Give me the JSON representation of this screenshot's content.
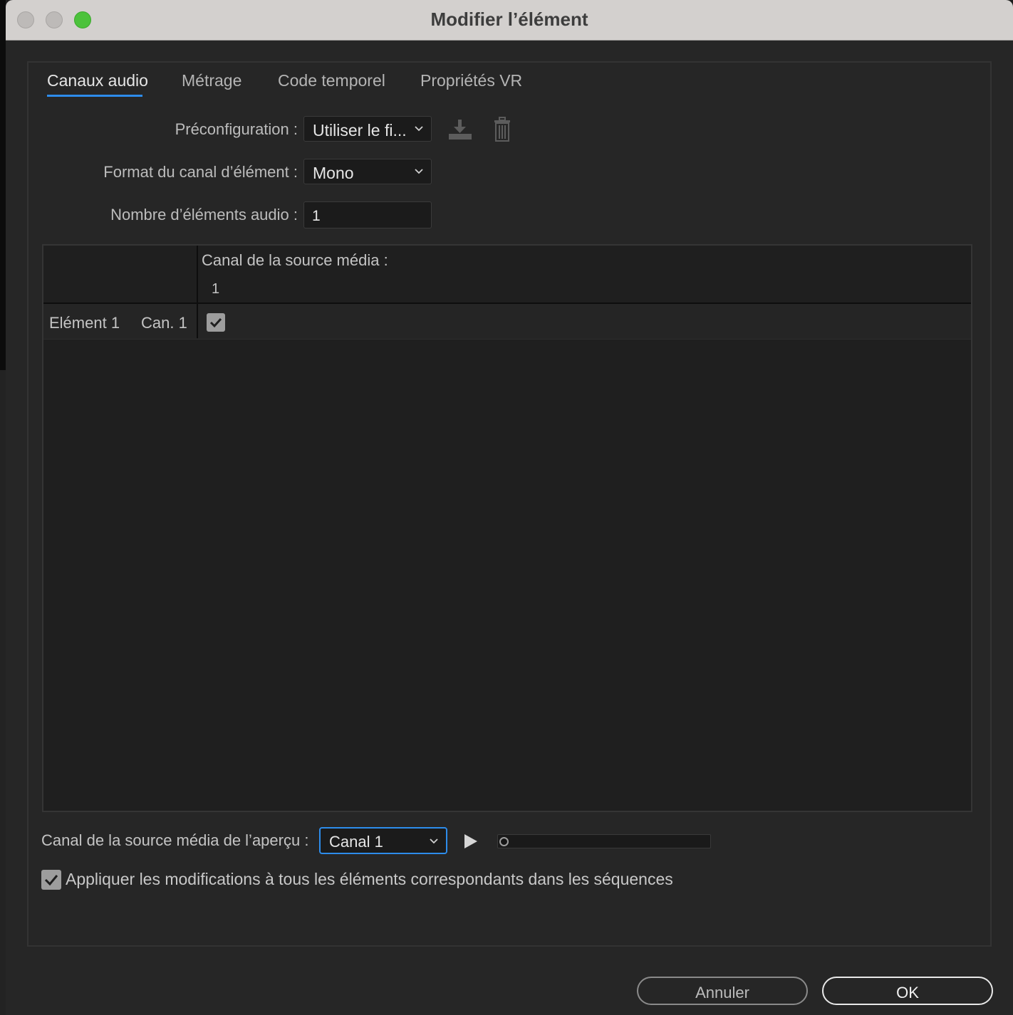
{
  "window": {
    "title": "Modifier l’élément"
  },
  "tabs": [
    {
      "label": "Canaux audio",
      "active": true
    },
    {
      "label": "Métrage",
      "active": false
    },
    {
      "label": "Code temporel",
      "active": false
    },
    {
      "label": "Propriétés VR",
      "active": false
    }
  ],
  "form": {
    "preset_label": "Préconfiguration :",
    "preset_value": "Utiliser le fi...",
    "format_label": "Format du canal d’élément :",
    "format_value": "Mono",
    "count_label": "Nombre d’éléments audio :",
    "count_value": "1"
  },
  "grid": {
    "source_header": "Canal de la source média :",
    "source_channels": [
      "1"
    ],
    "rows": [
      {
        "element": "Elément 1",
        "channel": "Can. 1",
        "checked": [
          true
        ]
      }
    ]
  },
  "preview": {
    "label": "Canal de la source média de l’aperçu :",
    "value": "Canal 1",
    "progress": 0
  },
  "apply": {
    "label": "Appliquer les modifications à tous les éléments correspondants dans les séquences",
    "checked": true
  },
  "buttons": {
    "cancel": "Annuler",
    "ok": "OK"
  },
  "colors": {
    "accent": "#2d8ceb",
    "close_dot": "#bdbab8",
    "minimize_dot": "#bdbab8",
    "zoom_dot": "#4cc23c"
  }
}
